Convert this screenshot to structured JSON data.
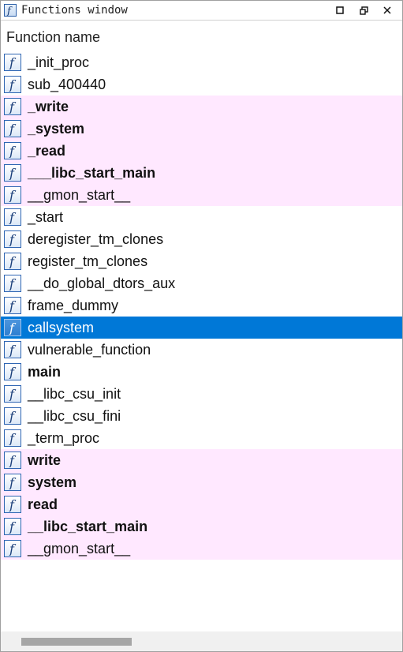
{
  "window": {
    "title": "Functions window"
  },
  "header": {
    "column": "Function name"
  },
  "functions": [
    {
      "name": "_init_proc",
      "bold": false,
      "pink": false,
      "selected": false
    },
    {
      "name": "sub_400440",
      "bold": false,
      "pink": false,
      "selected": false
    },
    {
      "name": "_write",
      "bold": true,
      "pink": true,
      "selected": false
    },
    {
      "name": "_system",
      "bold": true,
      "pink": true,
      "selected": false
    },
    {
      "name": "_read",
      "bold": true,
      "pink": true,
      "selected": false
    },
    {
      "name": "___libc_start_main",
      "bold": true,
      "pink": true,
      "selected": false
    },
    {
      "name": "__gmon_start__",
      "bold": false,
      "pink": true,
      "selected": false
    },
    {
      "name": "_start",
      "bold": false,
      "pink": false,
      "selected": false
    },
    {
      "name": "deregister_tm_clones",
      "bold": false,
      "pink": false,
      "selected": false
    },
    {
      "name": "register_tm_clones",
      "bold": false,
      "pink": false,
      "selected": false
    },
    {
      "name": "__do_global_dtors_aux",
      "bold": false,
      "pink": false,
      "selected": false
    },
    {
      "name": "frame_dummy",
      "bold": false,
      "pink": false,
      "selected": false
    },
    {
      "name": "callsystem",
      "bold": false,
      "pink": false,
      "selected": true
    },
    {
      "name": "vulnerable_function",
      "bold": false,
      "pink": false,
      "selected": false
    },
    {
      "name": "main",
      "bold": true,
      "pink": false,
      "selected": false
    },
    {
      "name": "__libc_csu_init",
      "bold": false,
      "pink": false,
      "selected": false
    },
    {
      "name": "__libc_csu_fini",
      "bold": false,
      "pink": false,
      "selected": false
    },
    {
      "name": "_term_proc",
      "bold": false,
      "pink": false,
      "selected": false
    },
    {
      "name": "write",
      "bold": true,
      "pink": true,
      "selected": false
    },
    {
      "name": "system",
      "bold": true,
      "pink": true,
      "selected": false
    },
    {
      "name": "read",
      "bold": true,
      "pink": true,
      "selected": false
    },
    {
      "name": "__libc_start_main",
      "bold": true,
      "pink": true,
      "selected": false
    },
    {
      "name": "__gmon_start__",
      "bold": false,
      "pink": true,
      "selected": false
    }
  ],
  "colors": {
    "import_highlight": "#ffe8ff",
    "selection": "#0078d7",
    "icon_border": "#2f66b3"
  },
  "icons": {
    "function": "function-icon",
    "maximize": "maximize-icon",
    "restore": "restore-icon",
    "close": "close-icon"
  }
}
